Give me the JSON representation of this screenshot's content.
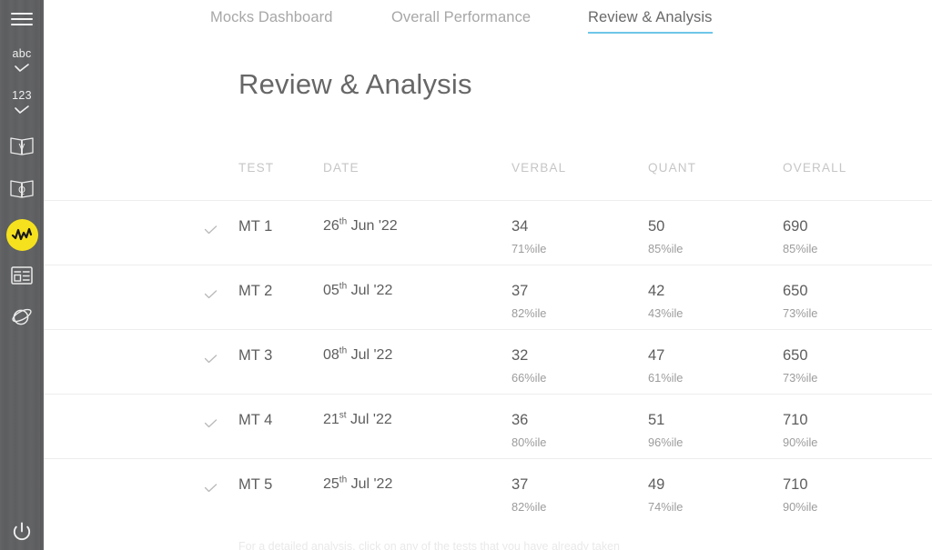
{
  "sidebar": {
    "background_color": "#5f6062",
    "accent_color": "#f5e11e",
    "items": [
      {
        "name": "menu",
        "icon": "hamburger-menu-icon",
        "label": ""
      },
      {
        "name": "verbal",
        "icon": "abc-check-icon",
        "label": "abc"
      },
      {
        "name": "quant",
        "icon": "123-check-icon",
        "label": "123"
      },
      {
        "name": "verbal-book",
        "icon": "book-v-icon",
        "label": "V"
      },
      {
        "name": "quant-book",
        "icon": "book-q-icon",
        "label": "Q"
      },
      {
        "name": "analysis",
        "icon": "analytics-zigzag-icon",
        "label": "",
        "active": true
      },
      {
        "name": "dashboard",
        "icon": "layout-list-icon",
        "label": ""
      },
      {
        "name": "explore",
        "icon": "planet-icon",
        "label": ""
      },
      {
        "name": "logout",
        "icon": "power-icon",
        "label": ""
      }
    ]
  },
  "tabs": {
    "active_index": 2,
    "underline_color": "#6ec6e8",
    "items": [
      {
        "label": "Mocks Dashboard"
      },
      {
        "label": "Overall Performance"
      },
      {
        "label": "Review & Analysis"
      }
    ]
  },
  "page": {
    "title": "Review & Analysis",
    "footer_note": "For a detailed analysis, click on any of the tests that you have already taken"
  },
  "table": {
    "columns": [
      "TEST",
      "DATE",
      "VERBAL",
      "QUANT",
      "OVERALL"
    ],
    "rows": [
      {
        "status_icon": "check-icon",
        "test": "MT 1",
        "date_day": "26",
        "date_suffix": "th",
        "date_rest": "Jun '22",
        "verbal": "34",
        "verbal_pct": "71%ile",
        "quant": "50",
        "quant_pct": "85%ile",
        "overall": "690",
        "overall_pct": "85%ile"
      },
      {
        "status_icon": "check-icon",
        "test": "MT 2",
        "date_day": "05",
        "date_suffix": "th",
        "date_rest": "Jul '22",
        "verbal": "37",
        "verbal_pct": "82%ile",
        "quant": "42",
        "quant_pct": "43%ile",
        "overall": "650",
        "overall_pct": "73%ile"
      },
      {
        "status_icon": "check-icon",
        "test": "MT 3",
        "date_day": "08",
        "date_suffix": "th",
        "date_rest": "Jul '22",
        "verbal": "32",
        "verbal_pct": "66%ile",
        "quant": "47",
        "quant_pct": "61%ile",
        "overall": "650",
        "overall_pct": "73%ile"
      },
      {
        "status_icon": "check-icon",
        "test": "MT 4",
        "date_day": "21",
        "date_suffix": "st",
        "date_rest": "Jul '22",
        "verbal": "36",
        "verbal_pct": "80%ile",
        "quant": "51",
        "quant_pct": "96%ile",
        "overall": "710",
        "overall_pct": "90%ile"
      },
      {
        "status_icon": "check-icon",
        "test": "MT 5",
        "date_day": "25",
        "date_suffix": "th",
        "date_rest": "Jul '22",
        "verbal": "37",
        "verbal_pct": "82%ile",
        "quant": "49",
        "quant_pct": "74%ile",
        "overall": "710",
        "overall_pct": "90%ile"
      }
    ]
  }
}
